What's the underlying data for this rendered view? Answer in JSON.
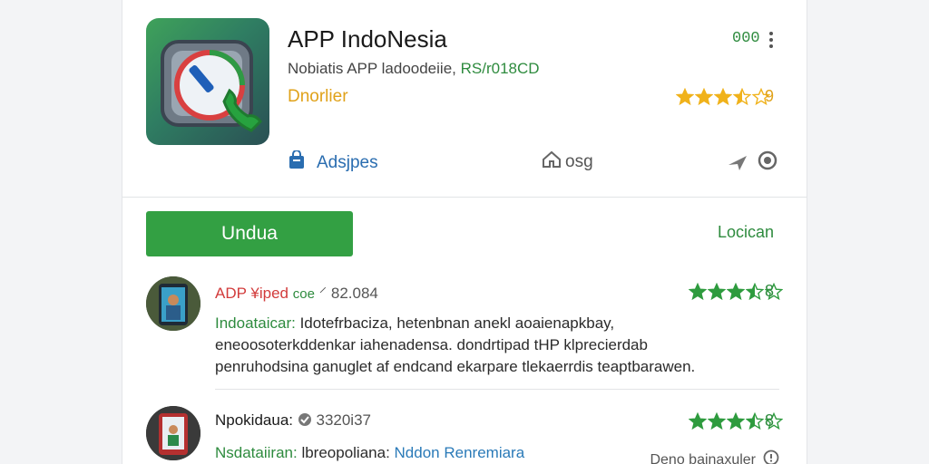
{
  "app": {
    "title": "APP IndoNesia",
    "version": "000",
    "developer": "Nobiatis APP ladoodeiie,",
    "developer_code": "RS/r018CD",
    "category": "Dnorlier",
    "rating": "9",
    "stars": [
      1,
      1,
      1,
      0.5,
      0
    ]
  },
  "actions": {
    "share_label": "Adsjpes",
    "home_label": "osg"
  },
  "install_label": "Undua",
  "secondary_label": "Locican",
  "reviews": [
    {
      "name": "ADP",
      "tag": "¥iped",
      "badge": "coe",
      "id": "⸍ 82.084",
      "rating": "8",
      "stars": [
        1,
        1,
        1,
        0.5,
        0
      ],
      "lead": "Indoataicar:",
      "line1": " Idotefrbaciza, hetenbnan anekl aoaienapkbay,",
      "line2": "eneoosoterkddenkar iahenadensa.  dondrtipad tHP klprecierdab",
      "line3": "penruhodsina ganuglet af endcand ekarpare tlekaerrdis teaptbarawen."
    },
    {
      "name": "Npokidaua:",
      "id": "3320i37",
      "rating": "8",
      "stars": [
        1,
        1,
        1,
        0.5,
        0
      ],
      "lead": "Nsdataiiran:",
      "line1_a": " lbreopoliana: ",
      "line1_b": "Nddon Renremiara",
      "see_more": "Deno bainaxuler"
    }
  ],
  "colors": {
    "accent_green": "#33a043",
    "star_gold": "#f0b21b",
    "star_green": "#2e9b3e",
    "link_blue": "#2a6db0"
  }
}
